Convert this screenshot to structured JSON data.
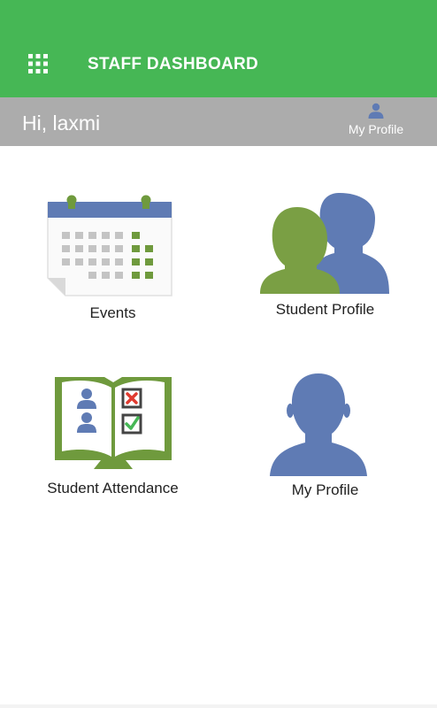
{
  "appbar": {
    "title": "STAFF DASHBOARD",
    "menu_icon": "apps-grid-icon",
    "color": "#46b755"
  },
  "greeting_bar": {
    "greeting": "Hi, laxmi",
    "profile_link_label": "My Profile",
    "profile_icon": "person-icon",
    "color": "#acacac"
  },
  "tiles": [
    {
      "label": "Events",
      "icon": "calendar-icon"
    },
    {
      "label": "Student Profile",
      "icon": "student-profile-icon"
    },
    {
      "label": "Student Attendance",
      "icon": "attendance-book-icon"
    },
    {
      "label": "My Profile",
      "icon": "my-profile-icon"
    }
  ],
  "colors": {
    "green_accent": "#6f9a3d",
    "blue_accent": "#5f7bb4"
  }
}
